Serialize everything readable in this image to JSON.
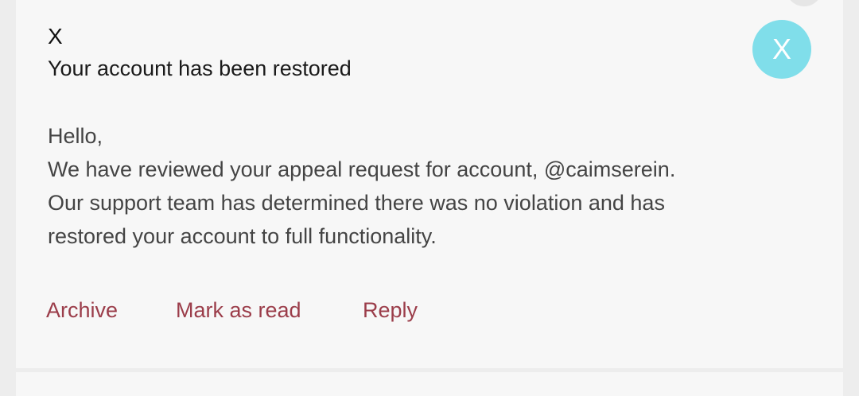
{
  "notification": {
    "sender": "X",
    "subject": "Your account has been restored",
    "avatar_letter": "X",
    "avatar_color": "#80deea",
    "body_lines": [
      "Hello,",
      "We have reviewed your appeal request for account, @caimserein.",
      "Our support team has determined there was no violation and has",
      "restored your account to full functionality."
    ],
    "actions": {
      "archive": "Archive",
      "mark_as_read": "Mark as read",
      "reply": "Reply"
    },
    "action_color": "#9b3d4a"
  }
}
